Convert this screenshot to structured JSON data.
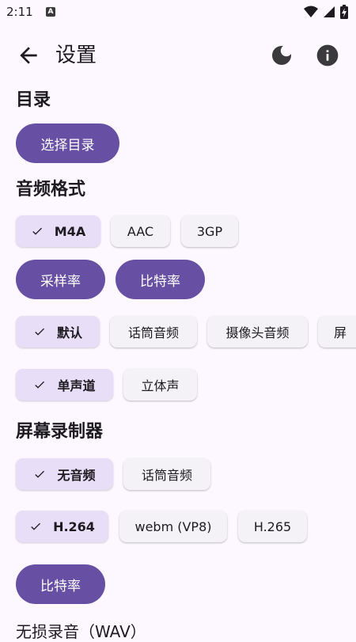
{
  "status_bar": {
    "time": "2:11",
    "notification_letter": "A"
  },
  "top_bar": {
    "title": "设置"
  },
  "sections": {
    "directory": {
      "title": "目录",
      "button": "选择目录"
    },
    "audio_format": {
      "title": "音频格式",
      "formats": [
        "M4A",
        "AAC",
        "3GP"
      ],
      "selected_format": "M4A",
      "sample_rate_button": "采样率",
      "bitrate_button": "比特率",
      "sources": [
        "默认",
        "话筒音频",
        "摄像头音频",
        "屏"
      ],
      "selected_source": "默认",
      "channels": [
        "单声道",
        "立体声"
      ],
      "selected_channel": "单声道"
    },
    "screen_recorder": {
      "title": "屏幕录制器",
      "audio_options": [
        "无音频",
        "话筒音频"
      ],
      "selected_audio": "无音频",
      "codecs": [
        "H.264",
        "webm (VP8)",
        "H.265"
      ],
      "selected_codec": "H.264",
      "bitrate_button": "比特率"
    },
    "lossless": {
      "title_partial": "无损录音（WAV）"
    }
  },
  "colors": {
    "background": "#FDF7FF",
    "primary": "#6750A4",
    "chip_selected": "#E8DEF8",
    "chip_unselected": "#F5F2F7"
  }
}
